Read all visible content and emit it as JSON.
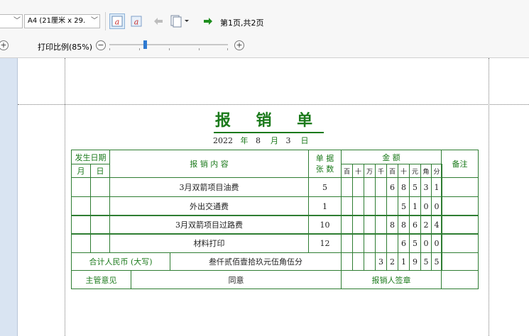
{
  "toolbar": {
    "paper_combo_value": "A4 (21厘米 x 29.",
    "page_status": "第1页,共2页",
    "zoom_label": "打印比例(85%)",
    "zoom_percent": 85
  },
  "form": {
    "title": "报 销 单",
    "date": {
      "year": "2022",
      "year_label": "年",
      "month": "8",
      "month_label": "月",
      "day": "3",
      "day_label": "日"
    },
    "headers": {
      "occur_date": "发生日期",
      "month": "月",
      "day": "日",
      "content": "报  销  内  容",
      "doc_count_1": "单 据",
      "doc_count_2": "张 数",
      "amount": "金     额",
      "remark": "备注",
      "digits": [
        "百",
        "十",
        "万",
        "千",
        "百",
        "十",
        "元",
        "角",
        "分"
      ]
    },
    "rows": [
      {
        "content": "3月双箭项目油费",
        "docs": "5",
        "digits": [
          "",
          "",
          "",
          "",
          "6",
          "8",
          "5",
          "3",
          "1"
        ]
      },
      {
        "content": "外出交通费",
        "docs": "1",
        "digits": [
          "",
          "",
          "",
          "",
          "",
          "5",
          "1",
          "0",
          "0"
        ]
      },
      {
        "content": "3月双箭项目过路费",
        "docs": "10",
        "digits": [
          "",
          "",
          "",
          "",
          "8",
          "8",
          "6",
          "2",
          "4"
        ]
      },
      {
        "content": "材料打印",
        "docs": "12",
        "digits": [
          "",
          "",
          "",
          "",
          "",
          "6",
          "5",
          "0",
          "0"
        ]
      }
    ],
    "total": {
      "label": "合计人民币 (大写)",
      "text": "叁仟贰佰壹拾玖元伍角伍分",
      "digits": [
        "",
        "",
        "",
        "3",
        "2",
        "1",
        "9",
        "5",
        "5"
      ]
    },
    "footer": {
      "manager_label": "主管意见",
      "manager_value": "同意",
      "signer_label": "报销人签章"
    }
  }
}
